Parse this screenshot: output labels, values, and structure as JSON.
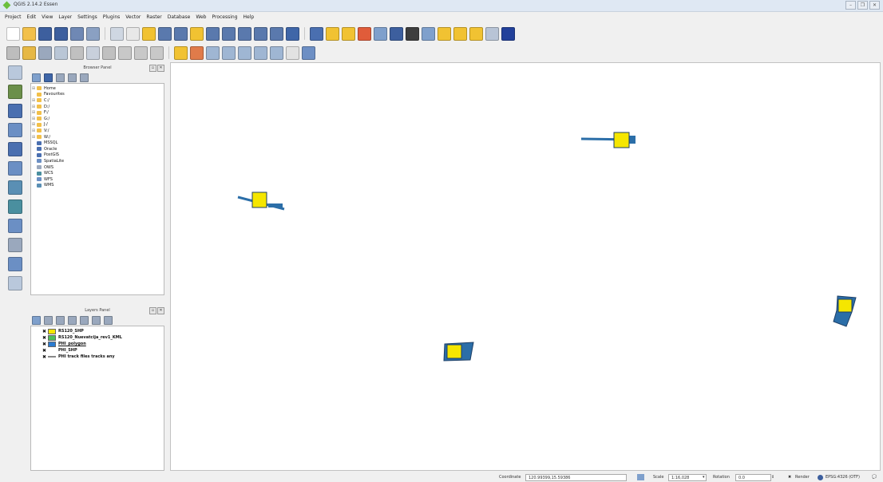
{
  "window": {
    "title": "QGIS 2.14.2 Essen",
    "buttons": [
      "–",
      "❐",
      "✕"
    ]
  },
  "menu": [
    "Project",
    "Edit",
    "View",
    "Layer",
    "Settings",
    "Plugins",
    "Vector",
    "Raster",
    "Database",
    "Web",
    "Processing",
    "Help"
  ],
  "toolbar_row1": [
    {
      "name": "new-project-icon",
      "color": "#ffffff"
    },
    {
      "name": "open-project-icon",
      "color": "#f2c04a"
    },
    {
      "name": "save-project-icon",
      "color": "#3d5f9e"
    },
    {
      "name": "save-as-icon",
      "color": "#3d5f9e"
    },
    {
      "name": "print-composer-icon",
      "color": "#6f88b4"
    },
    {
      "name": "composer-manager-icon",
      "color": "#8aa0c2"
    },
    {
      "sep": true
    },
    {
      "name": "pan-map-icon",
      "color": "#cfd7e2"
    },
    {
      "name": "pan-icon",
      "color": "#e8e8e8"
    },
    {
      "name": "pan-to-selection-icon",
      "color": "#f1c232"
    },
    {
      "name": "zoom-in-icon",
      "color": "#5a79ad"
    },
    {
      "name": "zoom-out-icon",
      "color": "#5a79ad"
    },
    {
      "name": "zoom-actual-icon",
      "color": "#f1c232"
    },
    {
      "name": "zoom-full-icon",
      "color": "#5a79ad"
    },
    {
      "name": "zoom-layer-icon",
      "color": "#5a79ad"
    },
    {
      "name": "zoom-selection-icon",
      "color": "#5a79ad"
    },
    {
      "name": "zoom-last-icon",
      "color": "#5a79ad"
    },
    {
      "name": "zoom-next-icon",
      "color": "#5a79ad"
    },
    {
      "name": "refresh-icon",
      "color": "#3f66a8"
    },
    {
      "sep": true
    },
    {
      "name": "identify-icon",
      "color": "#4a6fb0"
    },
    {
      "name": "select-icon",
      "color": "#f1c232"
    },
    {
      "name": "select-value-icon",
      "color": "#f1c232"
    },
    {
      "name": "deselect-icon",
      "color": "#e05c3a"
    },
    {
      "name": "table-icon",
      "color": "#7fa0cc"
    },
    {
      "name": "field-calc-icon",
      "color": "#3d5f9e"
    },
    {
      "name": "sum-icon",
      "color": "#3d3d3d"
    },
    {
      "name": "measure-icon",
      "color": "#7fa0cc"
    },
    {
      "name": "map-tips-icon",
      "color": "#f1c232"
    },
    {
      "name": "bookmark-icon",
      "color": "#f1c232"
    },
    {
      "name": "text-annotation-icon",
      "color": "#f1c232"
    },
    {
      "name": "tips-icon",
      "color": "#b8c4d6"
    },
    {
      "name": "help-icon",
      "color": "#22409a"
    }
  ],
  "toolbar_row2": [
    {
      "name": "edits-icon",
      "color": "#bdbdbd"
    },
    {
      "name": "toggle-edit-icon",
      "color": "#e6b845"
    },
    {
      "name": "save-edits-icon",
      "color": "#9aa8bd"
    },
    {
      "name": "add-feature-icon",
      "color": "#b9c6d6"
    },
    {
      "name": "move-feature-icon",
      "color": "#c0c0c0"
    },
    {
      "name": "node-tool-icon",
      "color": "#c8d0dc"
    },
    {
      "name": "delete-selected-icon",
      "color": "#c0c0c0"
    },
    {
      "name": "cut-icon",
      "color": "#c8c8c8"
    },
    {
      "name": "copy-icon",
      "color": "#c8c8c8"
    },
    {
      "name": "paste-icon",
      "color": "#c8c8c8"
    },
    {
      "sep": true
    },
    {
      "name": "label-icon",
      "color": "#f1c232"
    },
    {
      "name": "label-style-icon",
      "color": "#e07b4a"
    },
    {
      "name": "pin-label-icon",
      "color": "#9fb6d3"
    },
    {
      "name": "highlight-label-icon",
      "color": "#9fb6d3"
    },
    {
      "name": "move-label-icon",
      "color": "#9fb6d3"
    },
    {
      "name": "rotate-label-icon",
      "color": "#9fb6d3"
    },
    {
      "name": "change-label-icon",
      "color": "#9fb6d3"
    },
    {
      "name": "abc-icon",
      "color": "#e2e2e2"
    },
    {
      "name": "digitize-icon",
      "color": "#6d8fc4"
    }
  ],
  "left_toolbar": [
    {
      "name": "add-vector-layer-icon",
      "color": "#b9c8dc"
    },
    {
      "name": "add-raster-layer-icon",
      "color": "#6b8f4a"
    },
    {
      "name": "add-postgis-icon",
      "color": "#4a6fb0"
    },
    {
      "name": "add-spatialite-icon",
      "color": "#6b8fc4"
    },
    {
      "name": "add-mssql-icon",
      "color": "#4a6fb0"
    },
    {
      "name": "add-oracle-icon",
      "color": "#6b8fc4"
    },
    {
      "name": "add-wms-icon",
      "color": "#5a8fb4"
    },
    {
      "name": "add-wcs-icon",
      "color": "#4a8f9f"
    },
    {
      "name": "add-wfs-icon",
      "color": "#6b8fc4"
    },
    {
      "name": "add-delimited-text-icon",
      "color": "#9aa8bd"
    },
    {
      "name": "new-shapefile-icon",
      "color": "#6b8fc4"
    },
    {
      "name": "new-layer-icon",
      "color": "#b9c8dc"
    }
  ],
  "browser_panel": {
    "title": "Browser Panel",
    "tools": [
      {
        "name": "add-selected-icon",
        "color": "#7fa0cc"
      },
      {
        "name": "refresh-icon",
        "color": "#3f66a8"
      },
      {
        "name": "filter-icon",
        "color": "#9aa8bd"
      },
      {
        "name": "collapse-icon",
        "color": "#9aa8bd"
      },
      {
        "name": "properties-icon",
        "color": "#9aa8bd"
      }
    ],
    "items": [
      {
        "label": "Home",
        "expander": "⊞",
        "color": "#f2c04a"
      },
      {
        "label": "Favourites",
        "expander": "",
        "color": "#f2c04a"
      },
      {
        "label": "C:/",
        "expander": "⊞",
        "color": "#f2c04a"
      },
      {
        "label": "D:/",
        "expander": "⊞",
        "color": "#f2c04a"
      },
      {
        "label": "F:/",
        "expander": "⊞",
        "color": "#f2c04a"
      },
      {
        "label": "G:/",
        "expander": "⊞",
        "color": "#f2c04a"
      },
      {
        "label": "J:/",
        "expander": "⊞",
        "color": "#f2c04a"
      },
      {
        "label": "V:/",
        "expander": "⊞",
        "color": "#f2c04a"
      },
      {
        "label": "W:/",
        "expander": "⊞",
        "color": "#f2c04a"
      },
      {
        "label": "MSSQL",
        "expander": "",
        "color": "#4a6fb0"
      },
      {
        "label": "Oracle",
        "expander": "",
        "color": "#4a6fb0"
      },
      {
        "label": "PostGIS",
        "expander": "",
        "color": "#4a6fb0"
      },
      {
        "label": "SpatiaLite",
        "expander": "",
        "color": "#6b8fc4"
      },
      {
        "label": "OWS",
        "expander": "",
        "color": "#9aa8bd"
      },
      {
        "label": "WCS",
        "expander": "",
        "color": "#4a8f9f"
      },
      {
        "label": "WFS",
        "expander": "",
        "color": "#6b8fc4"
      },
      {
        "label": "WMS",
        "expander": "",
        "color": "#5a8fb4"
      }
    ]
  },
  "layers_panel": {
    "title": "Layers Panel",
    "tools": [
      {
        "name": "style-icon",
        "color": "#7fa0cc"
      },
      {
        "name": "add-group-icon",
        "color": "#9aa8bd"
      },
      {
        "name": "filter-legend-icon",
        "color": "#9aa8bd"
      },
      {
        "name": "filter-expression-icon",
        "color": "#9aa8bd"
      },
      {
        "name": "expand-all-icon",
        "color": "#9aa8bd"
      },
      {
        "name": "collapse-all-icon",
        "color": "#9aa8bd"
      },
      {
        "name": "remove-layer-icon",
        "color": "#9aa8bd"
      }
    ],
    "layers": [
      {
        "label": "RS120_SHP",
        "checked": "✖",
        "symbol": "fill",
        "color": "#f5e600"
      },
      {
        "label": "RS120_Nuevatcija_rev1_KML",
        "checked": "✖",
        "symbol": "fill",
        "color": "#4fbf5a"
      },
      {
        "label": "PHI_polygon",
        "checked": "✖",
        "symbol": "fill",
        "color": "#2b7bd0"
      },
      {
        "label": "PHI_SHP",
        "checked": "✖",
        "symbol": "none",
        "color": "#ffffff"
      },
      {
        "label": "PHI track files tracks any",
        "checked": "✖",
        "symbol": "line",
        "color": "#888888"
      }
    ]
  },
  "map": {
    "background": "#ffffff",
    "feature_colors": {
      "fill": "#f5e600",
      "polygon": "#2b6ea8",
      "outline": "#1d3f66"
    }
  },
  "statusbar": {
    "coordinate_label": "Coordinate",
    "coordinate_value": "120.99399,15.59386",
    "scale_label": "Scale",
    "scale_value": "1:16,028",
    "rotation_label": "Rotation",
    "rotation_value": "0.0",
    "render_label": "Render",
    "crs_label": "EPSG:4326 (OTF)"
  }
}
